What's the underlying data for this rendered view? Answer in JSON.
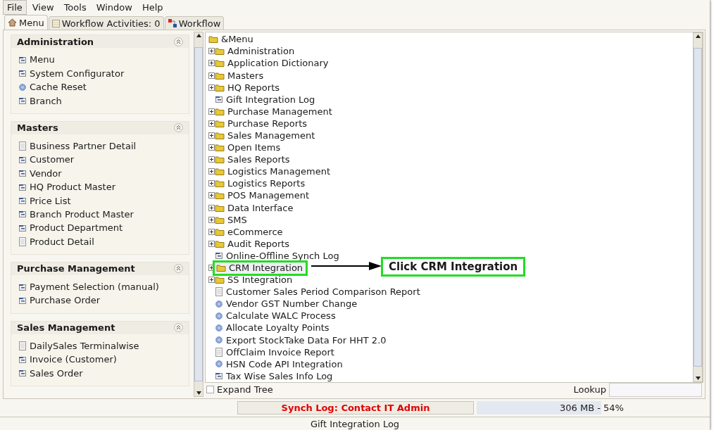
{
  "menu_bar": [
    {
      "label": "File",
      "selected": true
    },
    {
      "label": "View",
      "selected": false
    },
    {
      "label": "Tools",
      "selected": false
    },
    {
      "label": "Window",
      "selected": false
    },
    {
      "label": "Help",
      "selected": false
    }
  ],
  "tabs": [
    {
      "label": "Menu",
      "kind": "home",
      "selected": true
    },
    {
      "label": "Workflow Activities: 0",
      "kind": "list",
      "selected": false
    },
    {
      "label": "Workflow",
      "kind": "flow",
      "selected": false
    }
  ],
  "sidebar": {
    "sections": [
      {
        "title": "Administration",
        "expanded": true,
        "items": [
          {
            "label": "Menu",
            "kind": "window"
          },
          {
            "label": "System Configurator",
            "kind": "window"
          },
          {
            "label": "Cache Reset",
            "kind": "process"
          },
          {
            "label": "Branch",
            "kind": "window"
          }
        ]
      },
      {
        "title": "Masters",
        "expanded": true,
        "items": [
          {
            "label": "Business Partner Detail",
            "kind": "report"
          },
          {
            "label": "Customer",
            "kind": "window"
          },
          {
            "label": "Vendor",
            "kind": "window"
          },
          {
            "label": "HQ Product Master",
            "kind": "window"
          },
          {
            "label": "Price List",
            "kind": "window"
          },
          {
            "label": "Branch Product Master",
            "kind": "window"
          },
          {
            "label": "Product Department",
            "kind": "window"
          },
          {
            "label": "Product Detail",
            "kind": "report"
          }
        ]
      },
      {
        "title": "Purchase Management",
        "expanded": true,
        "items": [
          {
            "label": "Payment Selection (manual)",
            "kind": "window"
          },
          {
            "label": "Purchase Order",
            "kind": "window"
          }
        ]
      },
      {
        "title": "Sales Management",
        "expanded": true,
        "items": [
          {
            "label": "DailySales Terminalwise",
            "kind": "report"
          },
          {
            "label": "Invoice (Customer)",
            "kind": "window"
          },
          {
            "label": "Sales Order",
            "kind": "window"
          }
        ]
      }
    ]
  },
  "tree": {
    "root": "&Menu",
    "items": [
      {
        "label": "Administration",
        "kind": "folder",
        "highlighted": false
      },
      {
        "label": "Application Dictionary",
        "kind": "folder",
        "highlighted": false
      },
      {
        "label": "Masters",
        "kind": "folder",
        "highlighted": false
      },
      {
        "label": "HQ Reports",
        "kind": "folder",
        "highlighted": false
      },
      {
        "label": "Gift Integration Log",
        "kind": "window",
        "highlighted": false
      },
      {
        "label": "Purchase Management",
        "kind": "folder",
        "highlighted": false
      },
      {
        "label": "Purchase Reports",
        "kind": "folder",
        "highlighted": false
      },
      {
        "label": "Sales Management",
        "kind": "folder",
        "highlighted": false
      },
      {
        "label": "Open Items",
        "kind": "folder",
        "highlighted": false
      },
      {
        "label": "Sales Reports",
        "kind": "folder",
        "highlighted": false
      },
      {
        "label": "Logistics Management",
        "kind": "folder",
        "highlighted": false
      },
      {
        "label": "Logistics Reports",
        "kind": "folder",
        "highlighted": false
      },
      {
        "label": "POS Management",
        "kind": "folder",
        "highlighted": false
      },
      {
        "label": "Data Interface",
        "kind": "folder",
        "highlighted": false
      },
      {
        "label": "SMS",
        "kind": "folder",
        "highlighted": false
      },
      {
        "label": "eCommerce",
        "kind": "folder",
        "highlighted": false
      },
      {
        "label": "Audit Reports",
        "kind": "folder",
        "highlighted": false
      },
      {
        "label": "Online-Offline Synch Log",
        "kind": "window",
        "highlighted": false
      },
      {
        "label": "CRM Integration",
        "kind": "folder",
        "highlighted": true
      },
      {
        "label": "SS Integration",
        "kind": "folder",
        "highlighted": false
      },
      {
        "label": "Customer Sales Period Comparison Report",
        "kind": "report",
        "highlighted": false
      },
      {
        "label": "Vendor GST Number Change",
        "kind": "process",
        "highlighted": false
      },
      {
        "label": "Calculate WALC Process",
        "kind": "process",
        "highlighted": false
      },
      {
        "label": "Allocate Loyalty Points",
        "kind": "process",
        "highlighted": false
      },
      {
        "label": "Export StockTake Data For HHT 2.0",
        "kind": "process",
        "highlighted": false
      },
      {
        "label": "OffClaim Invoice Report",
        "kind": "report",
        "highlighted": false
      },
      {
        "label": "HSN Code API Integration",
        "kind": "process",
        "highlighted": false
      },
      {
        "label": "Tax Wise Sales Info Log",
        "kind": "window",
        "highlighted": false
      }
    ]
  },
  "callout": {
    "text": "Click CRM Integration"
  },
  "expand_tree": {
    "label": "Expand Tree",
    "checked": false
  },
  "lookup": {
    "label": "Lookup"
  },
  "synch_log": "Synch Log: Contact IT Admin",
  "memory": {
    "text": "306 MB - 54%",
    "level": 0.54
  },
  "status_bar": "Gift Integration Log"
}
